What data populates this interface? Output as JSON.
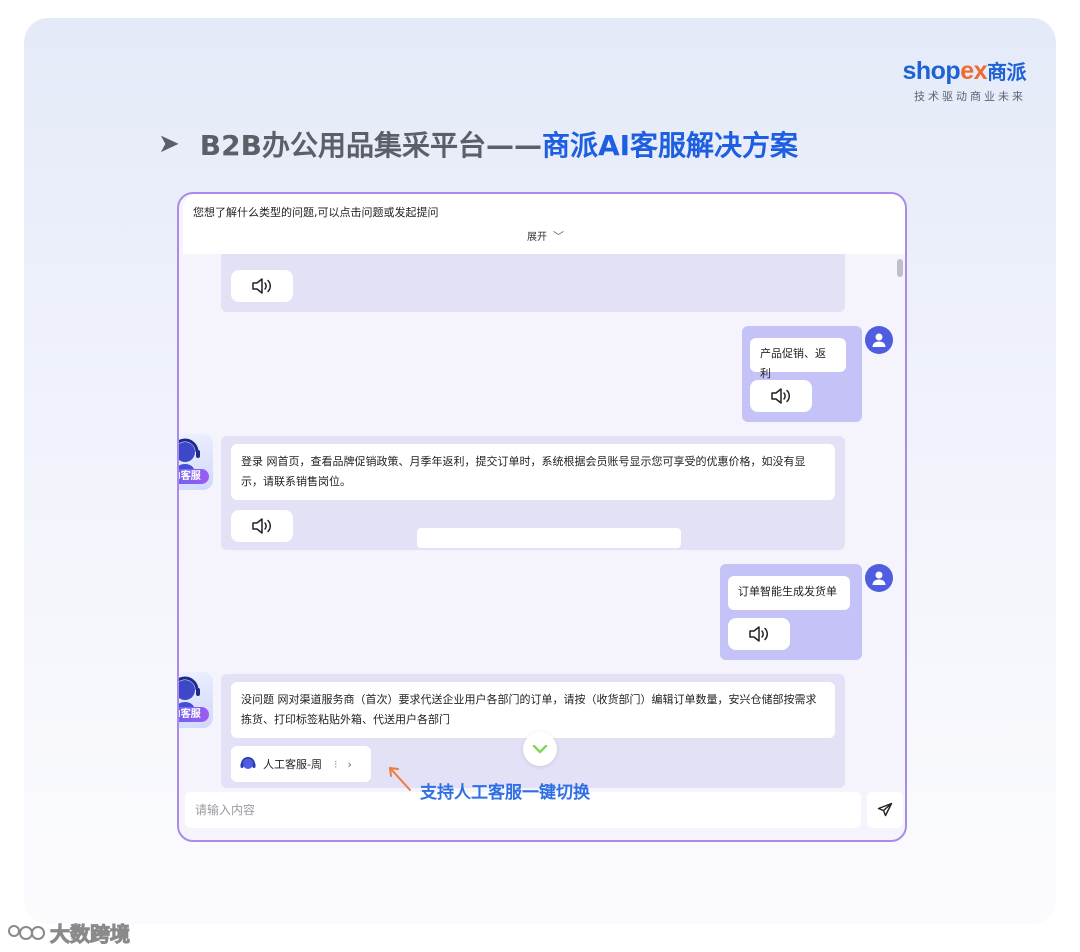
{
  "brand": {
    "logo_left": "shop",
    "logo_x": "ex",
    "logo_cn": "商派",
    "tagline": "技术驱动商业未来"
  },
  "heading": {
    "arrow": "➤",
    "prefix": "B2B办公用品集采平台——",
    "highlight": "商派AI客服解决方案"
  },
  "chat": {
    "prompt_bar": {
      "question": "您想了解什么类型的问题,可以点击问题或发起提问",
      "expand_label": "展开"
    },
    "messages": [
      {
        "role": "user",
        "text": "产品促销、返利"
      },
      {
        "role": "ai",
        "avatar_label": "AI客服",
        "text": "登录 网首页，查看品牌促销政策、月季年返利，提交订单时，系统根据会员账号显示您可享受的优惠价格，如没有显示，请联系销售岗位。"
      },
      {
        "role": "user",
        "text": "订单智能生成发货单"
      },
      {
        "role": "ai",
        "avatar_label": "AI客服",
        "text": "没问题 网对渠道服务商（首次）要求代送企业用户各部门的订单，请按（收货部门）编辑订单数量，安兴仓储部按需求拣货、打印标签粘贴外箱、代送用户各部门"
      }
    ],
    "handoff": {
      "label": "人工客服-周",
      "sep": "⁝"
    },
    "input": {
      "placeholder": "请输入内容"
    }
  },
  "annotation": "支持人工客服一键切换",
  "watermark": "大数跨境",
  "colors": {
    "accent_blue": "#1d5fe0",
    "chat_border": "#a98be8",
    "user_bubble_bg": "#c4c2f6",
    "ai_bubble_bg": "#e3e1f5"
  }
}
